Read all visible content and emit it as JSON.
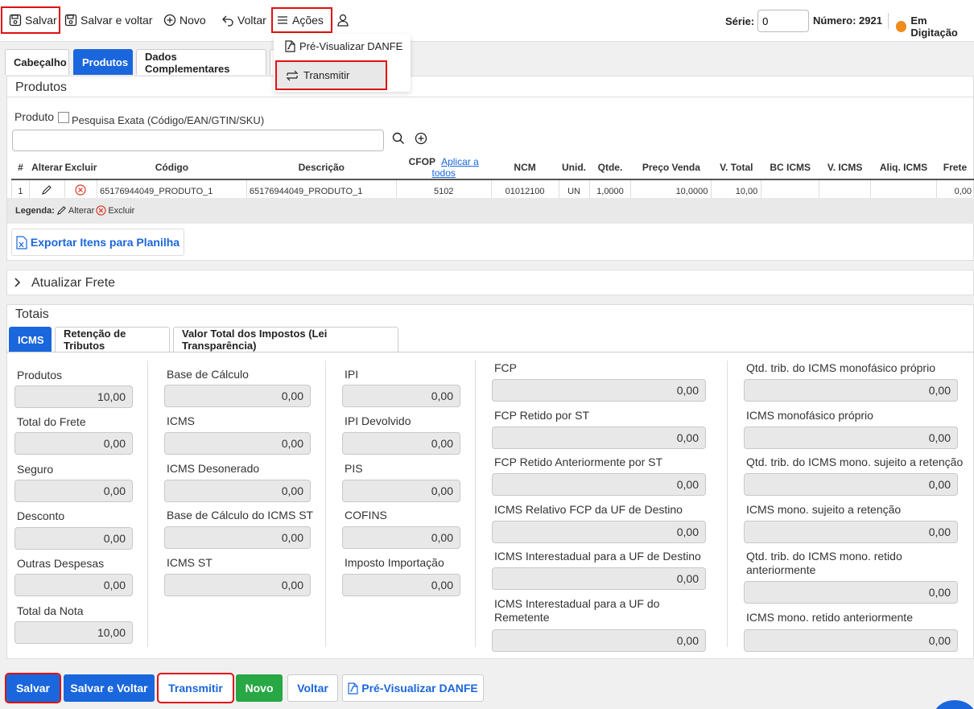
{
  "toolbar": {
    "save": "Salvar",
    "save_back": "Salvar e voltar",
    "new": "Novo",
    "back": "Voltar",
    "actions": "Ações",
    "serie_label": "Série:",
    "serie_value": "0",
    "number_label": "Número: 2921",
    "status": "Em Digitação"
  },
  "actions_menu": {
    "preview": "Pré-Visualizar DANFE",
    "transmit": "Transmitir"
  },
  "tabs": [
    "Cabeçalho",
    "Produtos",
    "Dados Complementares"
  ],
  "products": {
    "title": "Produtos",
    "product_label": "Produto",
    "exact_search": "Pesquisa Exata (Código/EAN/GTIN/SKU)",
    "columns": [
      "#",
      "Alterar",
      "Excluir",
      "Código",
      "Descrição",
      "CFOP",
      "NCM",
      "Unid.",
      "Qtde.",
      "Preço Venda",
      "V. Total",
      "BC ICMS",
      "V. ICMS",
      "Aliq. ICMS",
      "Frete"
    ],
    "apply_all": "Aplicar a todos",
    "row": {
      "num": "1",
      "code": "65176944049_PRODUTO_1",
      "desc": "65176944049_PRODUTO_1",
      "cfop": "5102",
      "ncm": "01012100",
      "unit": "UN",
      "qty": "1,0000",
      "price": "10,0000",
      "total": "10,00",
      "frete": "0,00"
    },
    "legend_label": "Legenda:",
    "legend_edit": "Alterar",
    "legend_delete": "Excluir",
    "export": "Exportar Itens para Planilha"
  },
  "freight": {
    "title": "Atualizar Frete"
  },
  "totals": {
    "title": "Totais",
    "subtabs": [
      "ICMS",
      "Retenção de Tributos",
      "Valor Total dos Impostos (Lei Transparência)"
    ],
    "col1": [
      {
        "label": "Produtos",
        "value": "10,00"
      },
      {
        "label": "Total do Frete",
        "value": "0,00"
      },
      {
        "label": "Seguro",
        "value": "0,00"
      },
      {
        "label": "Desconto",
        "value": "0,00"
      },
      {
        "label": "Outras Despesas",
        "value": "0,00"
      },
      {
        "label": "Total da Nota",
        "value": "10,00"
      }
    ],
    "col2": [
      {
        "label": "Base de Cálculo",
        "value": "0,00"
      },
      {
        "label": "ICMS",
        "value": "0,00"
      },
      {
        "label": "ICMS Desonerado",
        "value": "0,00"
      },
      {
        "label": "Base de Cálculo do ICMS ST",
        "value": "0,00"
      },
      {
        "label": "ICMS ST",
        "value": "0,00"
      }
    ],
    "col3": [
      {
        "label": "IPI",
        "value": "0,00"
      },
      {
        "label": "IPI Devolvido",
        "value": "0,00"
      },
      {
        "label": "PIS",
        "value": "0,00"
      },
      {
        "label": "COFINS",
        "value": "0,00"
      },
      {
        "label": "Imposto Importação",
        "value": "0,00"
      }
    ],
    "col4": [
      {
        "label": "FCP",
        "value": "0,00"
      },
      {
        "label": "FCP Retido por ST",
        "value": "0,00"
      },
      {
        "label": "FCP Retido Anteriormente por ST",
        "value": "0,00"
      },
      {
        "label": "ICMS Relativo FCP da UF de Destino",
        "value": "0,00"
      },
      {
        "label": "ICMS Interestadual para a UF de Destino",
        "value": "0,00"
      },
      {
        "label": "ICMS Interestadual para a UF do Remetente",
        "value": "0,00"
      }
    ],
    "col5": [
      {
        "label": "Qtd. trib. do ICMS monofásico próprio",
        "value": "0,00"
      },
      {
        "label": "ICMS monofásico próprio",
        "value": "0,00"
      },
      {
        "label": "Qtd. trib. do ICMS mono. sujeito a retenção",
        "value": "0,00"
      },
      {
        "label": "ICMS mono. sujeito a retenção",
        "value": "0,00"
      },
      {
        "label": "Qtd. trib. do ICMS mono. retido anteriormente",
        "value": "0,00"
      },
      {
        "label": "ICMS mono. retido anteriormente",
        "value": "0,00"
      }
    ]
  },
  "footer": {
    "save": "Salvar",
    "save_back": "Salvar e Voltar",
    "transmit": "Transmitir",
    "new": "Novo",
    "back": "Voltar",
    "preview": "Pré-Visualizar DANFE"
  }
}
